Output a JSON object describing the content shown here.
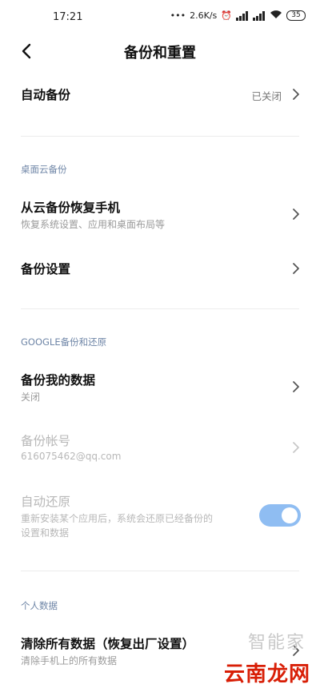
{
  "status_bar": {
    "time": "17:21",
    "speed": "2.6K/s",
    "battery": "35"
  },
  "header": {
    "title": "备份和重置"
  },
  "auto_backup": {
    "title": "自动备份",
    "value": "已关闭"
  },
  "cloud_section": {
    "label": "桌面云备份",
    "restore": {
      "title": "从云备份恢复手机",
      "subtitle": "恢复系统设置、应用和桌面布局等"
    },
    "settings": {
      "title": "备份设置"
    }
  },
  "google_section": {
    "label": "GOOGLE备份和还原",
    "backup_data": {
      "title": "备份我的数据",
      "subtitle": "关闭"
    },
    "backup_account": {
      "title": "备份帐号",
      "subtitle": "616075462@qq.com"
    },
    "auto_restore": {
      "title": "自动还原",
      "subtitle_line1": "重新安装某个应用后，系统会还原已经备份的",
      "subtitle_line2": "设置和数据",
      "enabled": true
    }
  },
  "personal_section": {
    "label": "个人数据",
    "factory_reset": {
      "title": "清除所有数据（恢复出厂设置）",
      "subtitle": "清除手机上的所有数据"
    }
  },
  "watermark": {
    "brand": "智能家",
    "site": "云南龙网"
  }
}
